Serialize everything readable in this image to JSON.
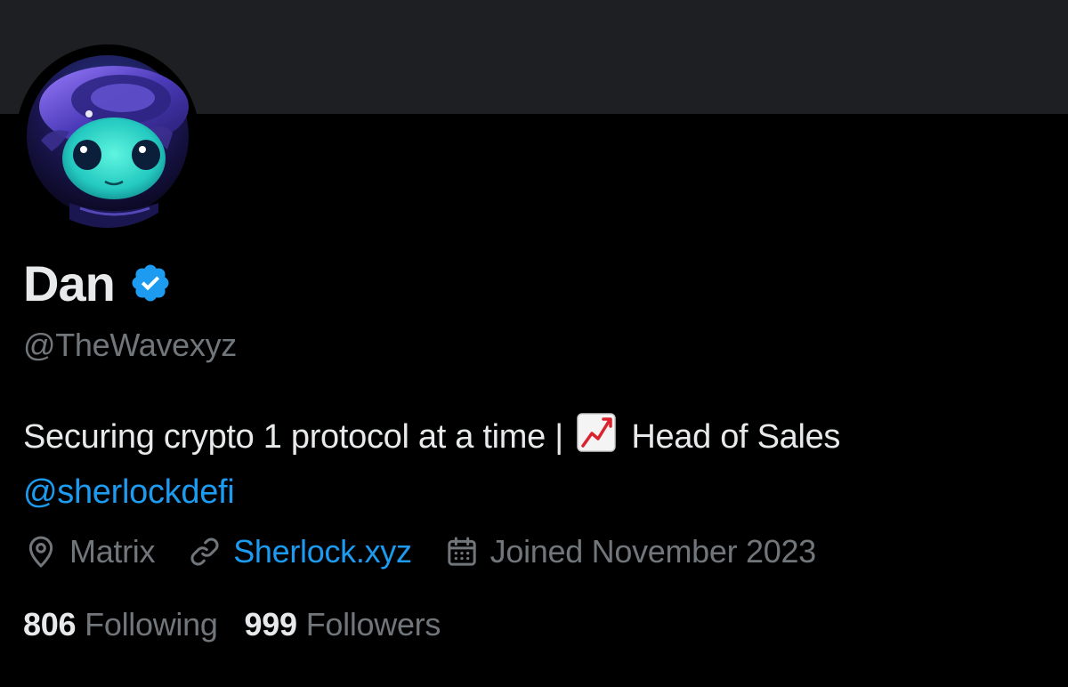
{
  "colors": {
    "background": "#000000",
    "banner": "#1e1f22",
    "primary_text": "#e7e9ea",
    "secondary_text": "#71767b",
    "accent_link": "#1d9bf0",
    "verified_badge": "#1d9bf0"
  },
  "profile": {
    "avatar_icon": "alien-avatar-image",
    "display_name": "Dan",
    "verified_icon": "verified-badge-icon",
    "handle": "@TheWavexyz",
    "bio": {
      "text_before": "Securing crypto 1 protocol at a time |",
      "emoji_icon": "chart-increasing-emoji",
      "text_after": "Head of Sales",
      "mention": "@sherlockdefi"
    },
    "meta": {
      "location_icon": "location-pin-icon",
      "location": "Matrix",
      "website_icon": "link-icon",
      "website": "Sherlock.xyz",
      "joined_icon": "calendar-icon",
      "joined": "Joined November 2023"
    },
    "stats": {
      "following_count": "806",
      "following_label": "Following",
      "followers_count": "999",
      "followers_label": "Followers"
    }
  }
}
